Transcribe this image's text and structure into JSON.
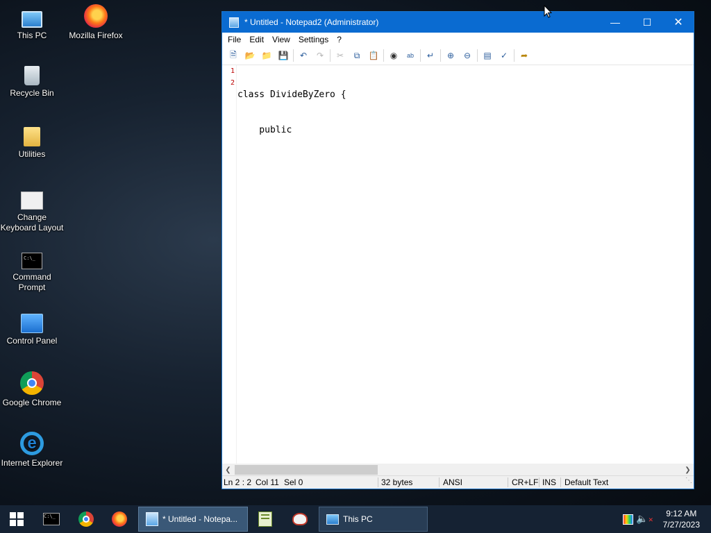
{
  "desktop": {
    "icons": [
      {
        "label": "This PC",
        "icon": "computer-icon"
      },
      {
        "label": "Mozilla Firefox",
        "icon": "firefox-icon"
      },
      {
        "label": "Recycle Bin",
        "icon": "recycle-bin-icon"
      },
      {
        "label": "Utilities",
        "icon": "folder-icon"
      },
      {
        "label": "Change Keyboard Layout",
        "icon": "keyboard-layout-icon"
      },
      {
        "label": "Command Prompt",
        "icon": "command-prompt-icon"
      },
      {
        "label": "Control Panel",
        "icon": "control-panel-icon"
      },
      {
        "label": "Google Chrome",
        "icon": "chrome-icon"
      },
      {
        "label": "Internet Explorer",
        "icon": "internet-explorer-icon"
      }
    ]
  },
  "window": {
    "title": "* Untitled - Notepad2 (Administrator)",
    "menu": [
      "File",
      "Edit",
      "View",
      "Settings",
      "?"
    ],
    "editor": {
      "line_numbers": [
        "1",
        "2"
      ],
      "lines": [
        "class DivideByZero {",
        "    public"
      ]
    },
    "status": {
      "position": "Ln 2 : 2",
      "column": "Col 11",
      "selection": "Sel 0",
      "size": "32 bytes",
      "encoding": "ANSI",
      "line_ending": "CR+LF",
      "mode": "INS",
      "scheme": "Default Text"
    }
  },
  "taskbar": {
    "tasks": [
      {
        "label": "* Untitled - Notepa...",
        "state": "active"
      },
      {
        "label": "This PC",
        "state": "inactive"
      }
    ],
    "clock": {
      "time": "9:12 AM",
      "date": "7/27/2023"
    }
  },
  "colors": {
    "titlebar": "#0a6bd1",
    "taskbar": "#152233",
    "line_number": "#b00000"
  }
}
